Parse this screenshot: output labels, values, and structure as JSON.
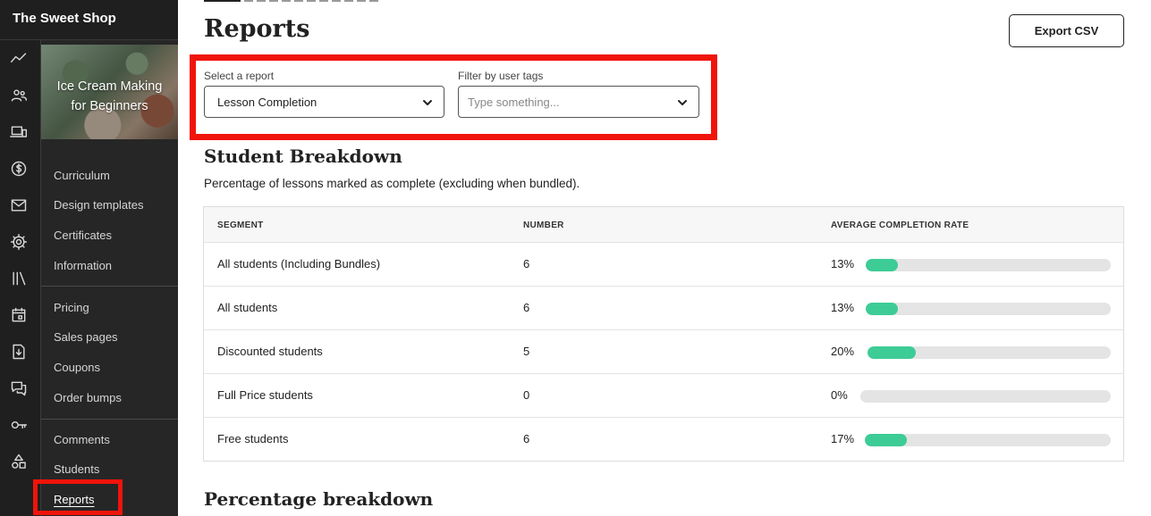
{
  "app": {
    "title": "The Sweet Shop"
  },
  "rail_icons": [
    "analytics-icon",
    "users-icon",
    "devices-icon",
    "dollar-icon",
    "mail-icon",
    "gear-icon",
    "library-icon",
    "calendar-icon",
    "download-icon",
    "chat-icon",
    "key-icon",
    "shapes-icon"
  ],
  "course": {
    "title_line1": "Ice Cream Making",
    "title_line2": "for Beginners",
    "nav_group1": [
      "Curriculum",
      "Design templates",
      "Certificates",
      "Information"
    ],
    "nav_group2": [
      "Pricing",
      "Sales pages",
      "Coupons",
      "Order bumps"
    ],
    "nav_group3": [
      "Comments",
      "Students",
      "Reports"
    ],
    "active_item": "Reports"
  },
  "page": {
    "title": "Reports",
    "export_label": "Export CSV"
  },
  "filters": {
    "report_label": "Select a report",
    "report_value": "Lesson Completion",
    "tags_label": "Filter by user tags",
    "tags_placeholder": "Type something..."
  },
  "breakdown": {
    "title": "Student Breakdown",
    "description": "Percentage of lessons marked as complete (excluding when bundled).",
    "columns": [
      "SEGMENT",
      "NUMBER",
      "AVERAGE COMPLETION RATE"
    ],
    "rows": [
      {
        "segment": "All students (Including Bundles)",
        "number": "6",
        "rate_label": "13%",
        "rate": 13
      },
      {
        "segment": "All students",
        "number": "6",
        "rate_label": "13%",
        "rate": 13
      },
      {
        "segment": "Discounted students",
        "number": "5",
        "rate_label": "20%",
        "rate": 20
      },
      {
        "segment": "Full Price students",
        "number": "0",
        "rate_label": "0%",
        "rate": 0
      },
      {
        "segment": "Free students",
        "number": "6",
        "rate_label": "17%",
        "rate": 17
      }
    ]
  },
  "percentage_section": {
    "title": "Percentage breakdown"
  },
  "colors": {
    "accent": "#3dcc96",
    "highlight": "#f0140a",
    "sidebar": "#1f1f1f"
  }
}
